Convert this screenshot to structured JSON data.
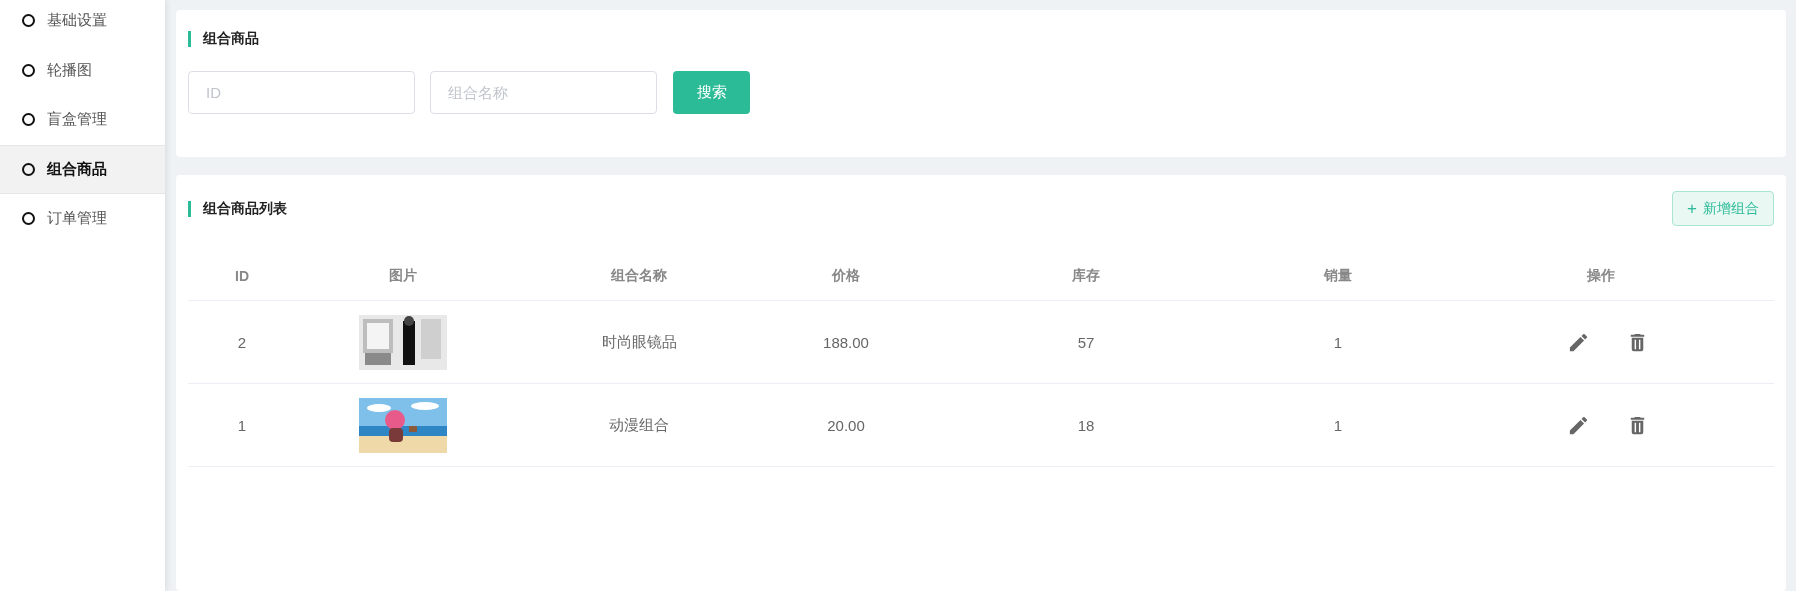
{
  "sidebar": {
    "items": [
      {
        "label": "基础设置",
        "selected": false
      },
      {
        "label": "轮播图",
        "selected": false
      },
      {
        "label": "盲盒管理",
        "selected": false
      },
      {
        "label": "组合商品",
        "selected": true
      },
      {
        "label": "订单管理",
        "selected": false
      }
    ]
  },
  "search_panel": {
    "title": "组合商品",
    "fields": [
      {
        "placeholder": "ID"
      },
      {
        "placeholder": "组合名称"
      }
    ],
    "button": "搜索"
  },
  "list_panel": {
    "title": "组合商品列表",
    "add_button": {
      "icon": "+",
      "label": "新增组合"
    },
    "table": {
      "columns": [
        "ID",
        "图片",
        "组合名称",
        "价格",
        "库存",
        "销量",
        "操作"
      ],
      "rows": [
        {
          "id": "2",
          "name": "时尚眼镜品",
          "price": "188.00",
          "stock": "57",
          "sales": "1"
        },
        {
          "id": "1",
          "name": "动漫组合",
          "price": "20.00",
          "stock": "18",
          "sales": "1"
        }
      ]
    }
  }
}
